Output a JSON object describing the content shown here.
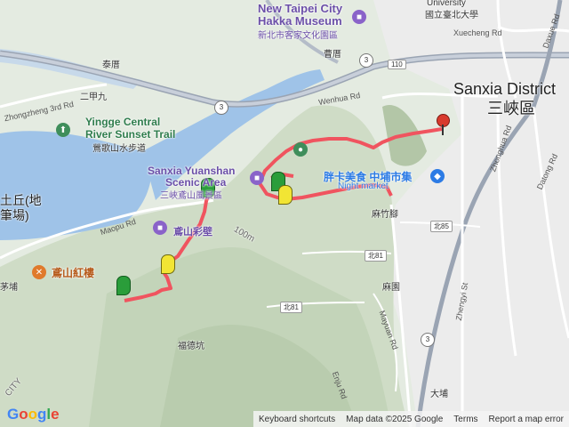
{
  "labels": {
    "hakka_en1": "New Taipei City",
    "hakka_en2": "Hakka Museum",
    "hakka_zh": "新北市客家文化園區",
    "univ_en": "University",
    "univ_zh": "國立臺北大學",
    "sanxia_en": "Sanxia District",
    "sanxia_zh": "三峽區",
    "xuecheng": "Xuecheng Rd",
    "daxue": "Daxue Rd",
    "taishan": "泰厝",
    "zhongzheng": "Zhongzheng 3rd Rd",
    "erjia": "二甲九",
    "yingge_en1": "Yingge Central",
    "yingge_en2": "River Sunset Trail",
    "yingge_zh": "鶯歌山水步道",
    "wenhua": "Wenhua Rd",
    "yuanshan_en1": "Sanxia Yuanshan",
    "yuanshan_en2": "Scenic Area",
    "yuanshan_zh": "三峽鳶山風景區",
    "maopu": "Maopu Rd",
    "wall_zh": "鳶山彩壁",
    "tuqiu": "土丘(地",
    "tuqiu2": "筆場)",
    "yuanshan_rest": "鳶山紅樓",
    "maopu_zh": "茅埔",
    "food_zh": "胖卡美食 中埔市集",
    "market_en": "Night market",
    "zhongzhu": "麻竹腳",
    "zhonghua": "Zhonghua Rd",
    "datong": "Datong Rd",
    "zhengyi": "Zhengyi St",
    "mayuan_rd": "Mayuan Rd",
    "mayuan": "麻園",
    "fudekeng": "福德坑",
    "enju": "Enju Rd",
    "dapu": "大埔",
    "city": "CITY",
    "caoling": "曹厝",
    "contour": "100m"
  },
  "shields": {
    "r3a": "3",
    "r3b": "3",
    "r3c": "3",
    "r110": "110",
    "bei81a": "北81",
    "bei81b": "北81",
    "bei85": "北85"
  },
  "footer": {
    "google": "Google",
    "shortcuts": "Keyboard shortcuts",
    "mapdata": "Map data ©2025 Google",
    "terms": "Terms",
    "report": "Report a map error"
  },
  "colors": {
    "route": "#f0545f",
    "start_flag": "#2a9d3a",
    "end_pin": "#d83a2d",
    "water": "#9fc3e8",
    "green": "#c9dfbf"
  },
  "markers": {
    "start": "start-flag",
    "end": "end-pin",
    "waypoints": "yellow-waypoint"
  }
}
